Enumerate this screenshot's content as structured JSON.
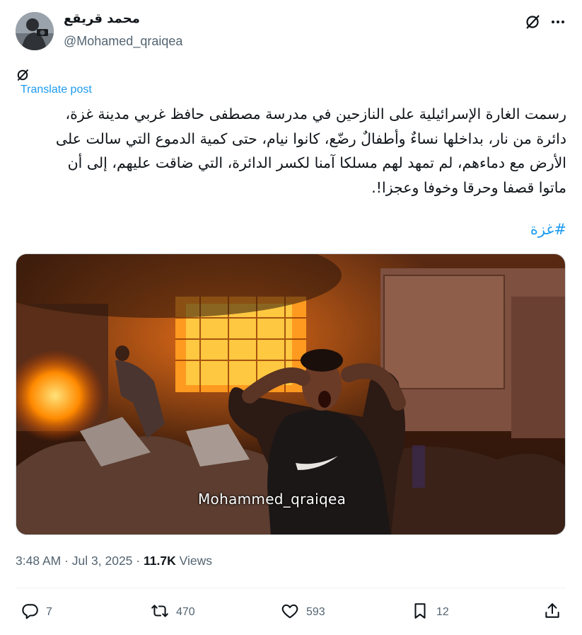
{
  "author": {
    "display_name": "محمد قريقع",
    "handle": "@Mohamed_qraiqea"
  },
  "header_icons": [
    "grok-icon",
    "more-icon"
  ],
  "translate_label": "Translate post",
  "tweet_text": "رسمت الغارة الإسرائيلية على النازحين في مدرسة مصطفى حافظ غربي مدينة غزة،\nدائرة من نار، بداخلها نساءٌ وأطفالٌ رضّع، كانوا نيام، حتى كمية الدموع التي سالت على\nالأرض مع دماءهم، لم تمهد لهم مسلكا آمنا لكسر الدائرة، التي ضاقت عليهم، إلى أن\nماتوا قصفا وحرقا وخوفا وعجزا!.",
  "hashtag": "#غزة",
  "media": {
    "watermark": "Mohammed_qraiqea",
    "colors": {
      "fire": "#ff8a00",
      "smoke": "#3a1d10",
      "wall": "#8a5b44"
    }
  },
  "meta": {
    "time": "3:48 AM",
    "date": "Jul 3, 2025",
    "separator": "·",
    "views_count": "11.7K",
    "views_label": "Views"
  },
  "actions": {
    "replies": "7",
    "reposts": "470",
    "likes": "593",
    "bookmarks": "12"
  },
  "colors": {
    "link": "#1d9bf0",
    "secondary_text": "#536471",
    "primary_text": "#0f1419"
  }
}
